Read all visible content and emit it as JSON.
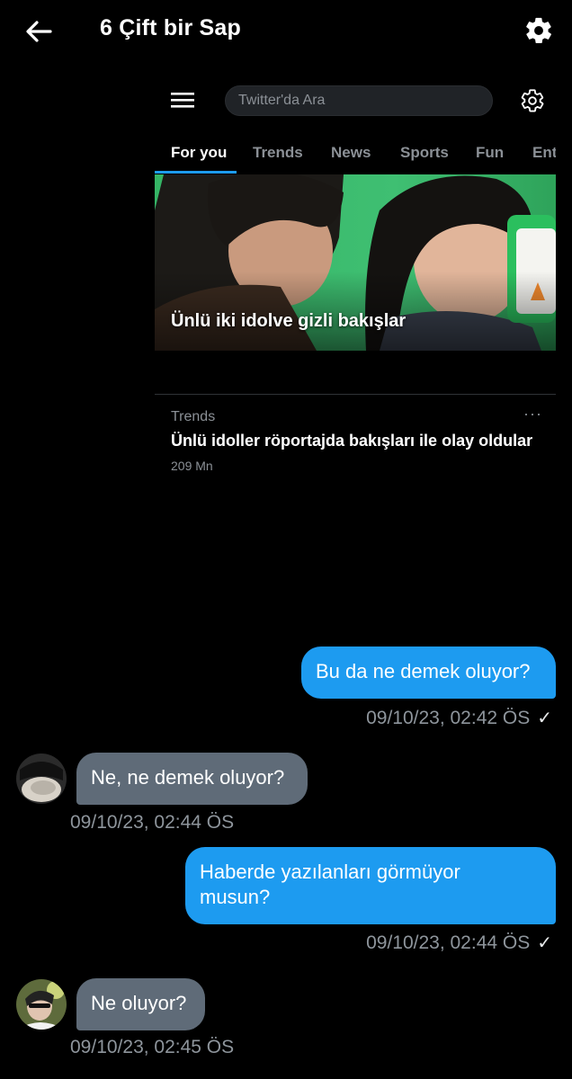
{
  "header": {
    "title": "6 Çift bir Sap"
  },
  "embed": {
    "search_placeholder": "Twitter'da Ara",
    "tabs": [
      "For you",
      "Trends",
      "News",
      "Sports",
      "Fun",
      "Ente"
    ],
    "active_tab": "For you",
    "hero_title": "Ünlü iki idolve gizli bakışlar",
    "trend": {
      "category": "Trends",
      "more": "···",
      "title": "Ünlü idoller röportajda bakışları ile olay oldular",
      "count": "209 Mn"
    }
  },
  "messages": [
    {
      "from": "me",
      "text": "Bu da ne demek oluyor?",
      "time": "09/10/23, 02:42 ÖS",
      "status": "✓"
    },
    {
      "from": "them",
      "text": "Ne, ne demek oluyor?",
      "time": "09/10/23, 02:44 ÖS"
    },
    {
      "from": "me",
      "text": "Haberde yazılanları görmüyor musun?",
      "time": "09/10/23, 02:44 ÖS",
      "status": "✓"
    },
    {
      "from": "them",
      "text": "Ne oluyor?",
      "time": "09/10/23, 02:45 ÖS"
    }
  ],
  "colors": {
    "background": "#000000",
    "sent_bubble": "#1d9bf0",
    "received_bubble": "#5f6b78",
    "timestamp": "#8e959c"
  }
}
